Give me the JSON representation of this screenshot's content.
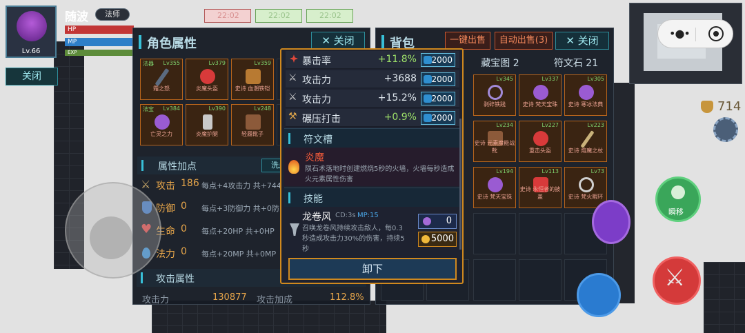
{
  "player": {
    "name": "随波",
    "class": "法师",
    "level": "Lv.66",
    "hp_label": "HP",
    "mp_label": "MP",
    "exp_label": "EXP",
    "hp_fill": 1.0,
    "mp_fill": 1.0
  },
  "left_close": "关闭",
  "timers": [
    "22:02",
    "22:02",
    "22:02"
  ],
  "char_panel": {
    "title": "角色属性",
    "close": "关闭",
    "slots": [
      {
        "lv": "Lv355",
        "name": "霜之怒",
        "tag": "法器"
      },
      {
        "lv": "Lv379",
        "name": "炎魔头盔",
        "tag": ""
      },
      {
        "lv": "Lv359",
        "name": "史诗 血潮铁铠",
        "tag": ""
      },
      {
        "lv": "",
        "name": "",
        "tag": ""
      },
      {
        "lv": "Lv384",
        "name": "亡灵之力",
        "tag": "法宝"
      },
      {
        "lv": "Lv390",
        "name": "炎魔护腿",
        "tag": ""
      },
      {
        "lv": "Lv248",
        "name": "轻履靴子",
        "tag": ""
      },
      {
        "lv": "",
        "name": "",
        "tag": ""
      }
    ],
    "attr_header": "属性加点",
    "wash": "洗点",
    "stats": [
      {
        "icon": "sword-icon",
        "label": "攻击",
        "value": "186",
        "desc": "每点+4攻击力 共+744"
      },
      {
        "icon": "shield-icon",
        "label": "防御",
        "value": "0",
        "desc": "每点+3防御力 共+0防"
      },
      {
        "icon": "heart-icon",
        "label": "生命",
        "value": "0",
        "desc": "每点+20HP 共+0HP"
      },
      {
        "icon": "drop-icon",
        "label": "法力",
        "value": "0",
        "desc": "每点+20MP 共+0MP"
      }
    ],
    "attack_header": "攻击属性",
    "atk_label": "攻击力",
    "atk_value": "130877",
    "atk_bonus_label": "攻击加成",
    "atk_bonus_value": "112.8%"
  },
  "bag": {
    "title": "背包",
    "sell_one": "一键出售",
    "auto_sell": "自动出售(3)",
    "close": "关闭",
    "tabs": [
      "藏宝图 2",
      "符文石 21"
    ],
    "items": [
      {
        "lv": "Lv345",
        "name": "剥碎铁践"
      },
      {
        "lv": "Lv337",
        "name": "史诗 梵天宝珠"
      },
      {
        "lv": "Lv305",
        "name": "史诗 寒冰法典"
      },
      {
        "lv": "Lv234",
        "name": "史诗 元素魔能战靴"
      },
      {
        "lv": "Lv227",
        "name": "重击头盔"
      },
      {
        "lv": "Lv223",
        "name": "史诗 熔魔之杖"
      },
      {
        "lv": "Lv194",
        "name": "史诗 梵天宝珠"
      },
      {
        "lv": "Lv113",
        "name": "史诗 永恒者的披盖"
      },
      {
        "lv": "Lv73",
        "name": "史诗 梵火暇环"
      }
    ]
  },
  "tooltip": {
    "stats": [
      {
        "icon": "crit-icon",
        "name": "暴击率",
        "value": "+11.8%",
        "cost": "2000"
      },
      {
        "icon": "swords-icon",
        "name": "攻击力",
        "value": "+3688",
        "cost": "2000"
      },
      {
        "icon": "swords-icon",
        "name": "攻击力",
        "value": "+15.2%",
        "cost": "2000"
      },
      {
        "icon": "hammer-icon",
        "name": "碾压打击",
        "value": "+0.9%",
        "cost": "2000"
      }
    ],
    "rune_header": "符文槽",
    "rune_name": "炎魔",
    "rune_desc": "陨石术落地时创建燃烧5秒的火墙，火墙每秒造成火元素属性伤害",
    "skill_header": "技能",
    "skill_name": "龙卷风",
    "skill_cd": "CD:3s",
    "skill_mp": "MP:15",
    "skill_desc": "召唤龙卷风持续攻击敌人，每0.3秒造成攻击力30%的伤害，持续5秒",
    "gem_cost": "0",
    "gold_cost": "5000",
    "unequip": "卸下"
  },
  "gold": "714",
  "dash_label": "瞬移",
  "colors": {
    "accent": "#38c0d8",
    "gold": "#e6a54a",
    "green": "#9ee26a",
    "tooltip_border": "#d0891e"
  }
}
